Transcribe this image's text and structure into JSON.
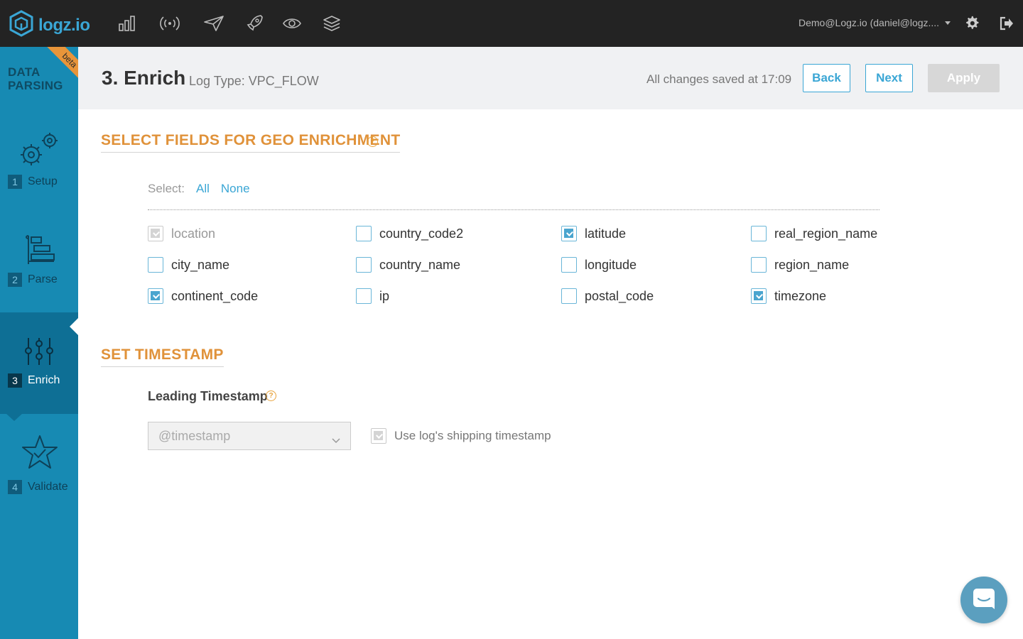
{
  "topbar": {
    "logo_text": "logz.io",
    "nav_icons": [
      "bar-chart-icon",
      "signal-icon",
      "send-icon",
      "rocket-icon",
      "eye-icon",
      "layers-icon"
    ],
    "user": "Demo@Logz.io (daniel@logz...."
  },
  "sidebar": {
    "brand_line1": "DATA",
    "brand_line2": "PARSING",
    "beta": "beta",
    "steps": [
      {
        "num": "1",
        "label": "Setup",
        "icon": "gears-icon",
        "active": false
      },
      {
        "num": "2",
        "label": "Parse",
        "icon": "parse-tree-icon",
        "active": false
      },
      {
        "num": "3",
        "label": "Enrich",
        "icon": "sliders-icon",
        "active": true
      },
      {
        "num": "4",
        "label": "Validate",
        "icon": "star-check-icon",
        "active": false
      }
    ]
  },
  "header": {
    "title": "3. Enrich",
    "log_type": "Log Type: VPC_FLOW",
    "saved": "All changes saved at 17:09",
    "back": "Back",
    "next": "Next",
    "apply": "Apply"
  },
  "geo": {
    "heading": "SELECT FIELDS FOR GEO ENRICHMENT",
    "help": "?",
    "select_label": "Select:",
    "all": "All",
    "none": "None",
    "fields": [
      {
        "label": "location",
        "state": "disabled"
      },
      {
        "label": "country_code2",
        "state": "unchecked"
      },
      {
        "label": "latitude",
        "state": "checked"
      },
      {
        "label": "real_region_name",
        "state": "unchecked"
      },
      {
        "label": "city_name",
        "state": "unchecked"
      },
      {
        "label": "country_name",
        "state": "unchecked"
      },
      {
        "label": "longitude",
        "state": "unchecked"
      },
      {
        "label": "region_name",
        "state": "unchecked"
      },
      {
        "label": "continent_code",
        "state": "checked"
      },
      {
        "label": "ip",
        "state": "unchecked"
      },
      {
        "label": "postal_code",
        "state": "unchecked"
      },
      {
        "label": "timezone",
        "state": "checked"
      }
    ]
  },
  "timestamp": {
    "heading": "SET TIMESTAMP",
    "leading_label": "Leading Timestamp",
    "help": "?",
    "selected": "@timestamp",
    "use_shipping": "Use log's shipping timestamp"
  },
  "colors": {
    "accent": "#3aa6d5",
    "orange": "#e0923a",
    "sidebar": "#178ab3",
    "topbar": "#232323"
  }
}
